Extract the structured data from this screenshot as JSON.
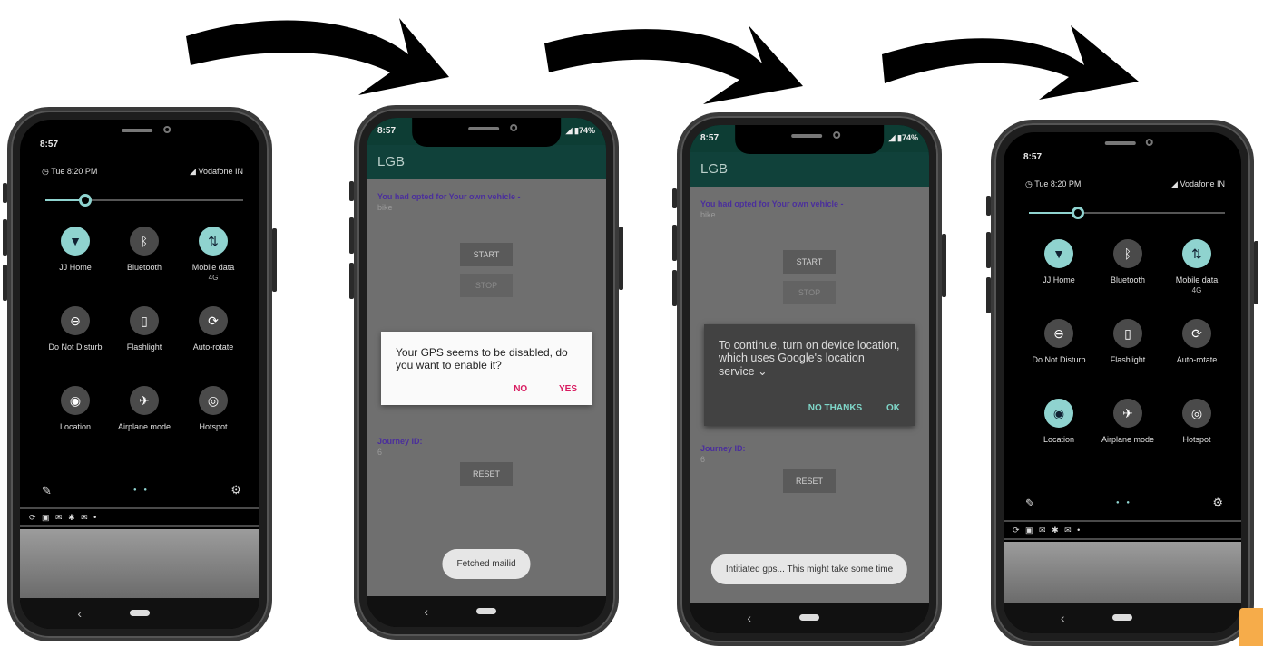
{
  "phone1": {
    "status_time": "8:57",
    "alarm": "Tue 8:20 PM",
    "carrier": "Vodafone IN",
    "brightness": 0.2,
    "tiles": [
      {
        "label": "JJ Home",
        "sub": "",
        "icon": "wifi-icon",
        "glyph": "▼",
        "on": true
      },
      {
        "label": "Bluetooth",
        "sub": "",
        "icon": "bluetooth-icon",
        "glyph": "ᛒ",
        "on": false
      },
      {
        "label": "Mobile data",
        "sub": "4G",
        "icon": "mobile-data-icon",
        "glyph": "⇅",
        "on": true
      },
      {
        "label": "Do Not Disturb",
        "sub": "",
        "icon": "dnd-icon",
        "glyph": "⊖",
        "on": false
      },
      {
        "label": "Flashlight",
        "sub": "",
        "icon": "flashlight-icon",
        "glyph": "▯",
        "on": false
      },
      {
        "label": "Auto-rotate",
        "sub": "",
        "icon": "rotate-icon",
        "glyph": "⟳",
        "on": false
      },
      {
        "label": "Location",
        "sub": "",
        "icon": "location-icon",
        "glyph": "◉",
        "on": false
      },
      {
        "label": "Airplane mode",
        "sub": "",
        "icon": "airplane-icon",
        "glyph": "✈",
        "on": false
      },
      {
        "label": "Hotspot",
        "sub": "",
        "icon": "hotspot-icon",
        "glyph": "◎",
        "on": false
      }
    ],
    "notif_icons": "⟳ ▣ ✉ ✱ ✉ •"
  },
  "phone2": {
    "status_time": "8:57",
    "status_right": "◢ ▮74%",
    "app_title": "LGB",
    "opted": "You had opted for Your own vehicle -",
    "vehicle": "bike",
    "start": "START",
    "stop": "STOP",
    "dialog_text": "Your GPS seems to be disabled, do you want to enable it?",
    "dialog_no": "NO",
    "dialog_yes": "YES",
    "journey_label": "Journey ID:",
    "journey_id": "6",
    "reset": "RESET",
    "toast": "Fetched mailid",
    "back": "‹"
  },
  "phone3": {
    "status_time": "8:57",
    "status_right": "◢ ▮74%",
    "app_title": "LGB",
    "opted": "You had opted for Your own vehicle -",
    "vehicle": "bike",
    "start": "START",
    "stop": "STOP",
    "dialog_text": "To continue, turn on device location, which uses Google's location service ⌄",
    "dialog_no": "NO THANKS",
    "dialog_ok": "OK",
    "journey_label": "Journey ID:",
    "journey_id": "6",
    "reset": "RESET",
    "toast": "Intitiated gps... This might take some time",
    "back": "‹"
  },
  "phone4": {
    "status_time": "8:57",
    "alarm": "Tue 8:20 PM",
    "carrier": "Vodafone IN",
    "brightness": 0.25,
    "tiles": [
      {
        "label": "JJ Home",
        "sub": "",
        "icon": "wifi-icon",
        "glyph": "▼",
        "on": true
      },
      {
        "label": "Bluetooth",
        "sub": "",
        "icon": "bluetooth-icon",
        "glyph": "ᛒ",
        "on": false
      },
      {
        "label": "Mobile data",
        "sub": "4G",
        "icon": "mobile-data-icon",
        "glyph": "⇅",
        "on": true
      },
      {
        "label": "Do Not Disturb",
        "sub": "",
        "icon": "dnd-icon",
        "glyph": "⊖",
        "on": false
      },
      {
        "label": "Flashlight",
        "sub": "",
        "icon": "flashlight-icon",
        "glyph": "▯",
        "on": false
      },
      {
        "label": "Auto-rotate",
        "sub": "",
        "icon": "rotate-icon",
        "glyph": "⟳",
        "on": false
      },
      {
        "label": "Location",
        "sub": "",
        "icon": "location-icon",
        "glyph": "◉",
        "on": true
      },
      {
        "label": "Airplane mode",
        "sub": "",
        "icon": "airplane-icon",
        "glyph": "✈",
        "on": false
      },
      {
        "label": "Hotspot",
        "sub": "",
        "icon": "hotspot-icon",
        "glyph": "◎",
        "on": false
      }
    ],
    "notif_icons": "⟳ ▣ ✉ ✱ ✉ •"
  },
  "common": {
    "pencil_glyph": "✎",
    "dots_glyph": "● ●",
    "gear_glyph": "⚙",
    "back_glyph": "‹"
  },
  "colors": {
    "accent": "#8fd3cf",
    "app_bar": "#10413a",
    "dialog_button": "#d81b60",
    "dark_dialog_button": "#7fd7c9",
    "orange_corner": "#f6ac4a"
  }
}
